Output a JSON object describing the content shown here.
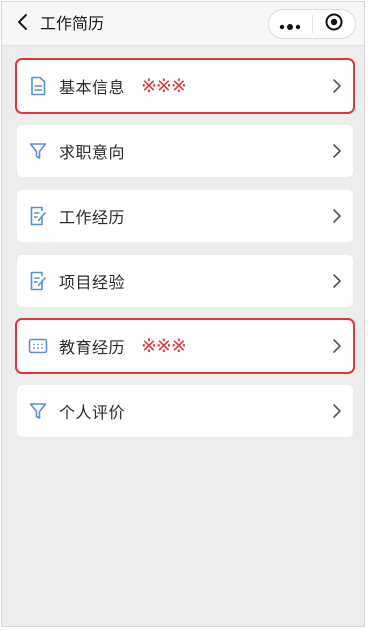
{
  "navbar": {
    "title": "工作简历",
    "back_icon": "chevron-left-icon",
    "more_icon": "more-dots-icon",
    "close_icon": "target-circle-icon"
  },
  "highlight_color": "#e0353b",
  "icon_color": "#5b8fd6",
  "items": [
    {
      "label": "基本信息",
      "icon": "document-icon",
      "badge": "※※※",
      "highlighted": true
    },
    {
      "label": "求职意向",
      "icon": "filter-icon",
      "badge": "",
      "highlighted": false
    },
    {
      "label": "工作经历",
      "icon": "edit-document-icon",
      "badge": "",
      "highlighted": false
    },
    {
      "label": "项目经验",
      "icon": "edit-document-icon",
      "badge": "",
      "highlighted": false
    },
    {
      "label": "教育经历",
      "icon": "calendar-icon",
      "badge": "※※※",
      "highlighted": true
    },
    {
      "label": "个人评价",
      "icon": "filter-icon",
      "badge": "",
      "highlighted": false
    }
  ]
}
